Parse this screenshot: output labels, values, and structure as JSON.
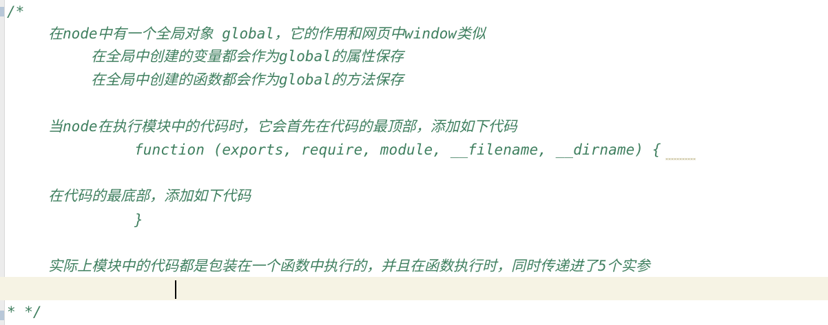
{
  "editor": {
    "lines": [
      "/*",
      "在node中有一个全局对象 global，它的作用和网页中window类似",
      "在全局中创建的变量都会作为global的属性保存",
      "在全局中创建的函数都会作为global的方法保存",
      "",
      "当node在执行模块中的代码时，它会首先在代码的最顶部，添加如下代码",
      "function (exports, require, module, __filename, __dirname) {",
      "",
      "在代码的最底部，添加如下代码",
      "}",
      "",
      "实际上模块中的代码都是包装在一个函数中执行的，并且在函数执行时，同时传递进了5个实参",
      "",
      "* */"
    ]
  },
  "colors": {
    "comment": "#3f7f5f",
    "current_line": "#f6f3e4",
    "background": "#ffffff"
  }
}
